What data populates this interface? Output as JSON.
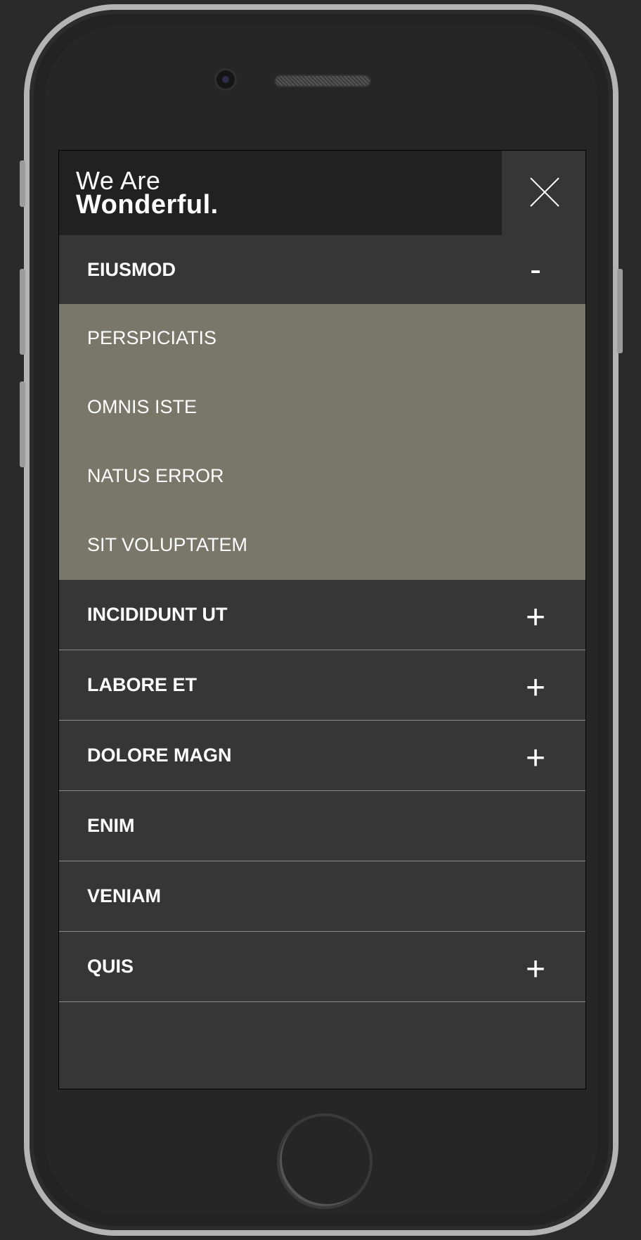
{
  "logo": {
    "line1": "We Are",
    "line2": "Wonderful."
  },
  "close_icon": "close-icon",
  "menu": {
    "expanded": {
      "label": "EIUSMOD",
      "toggle": "-",
      "children": [
        "PERSPICIATIS",
        "OMNIS ISTE",
        "NATUS ERROR",
        "SIT VOLUPTATEM"
      ]
    },
    "items": [
      {
        "label": "INCIDIDUNT UT",
        "toggle": "+"
      },
      {
        "label": "LABORE ET",
        "toggle": "+"
      },
      {
        "label": "DOLORE MAGN",
        "toggle": "+"
      },
      {
        "label": "ENIM",
        "toggle": ""
      },
      {
        "label": "VENIAM",
        "toggle": ""
      },
      {
        "label": "QUIS",
        "toggle": "+"
      }
    ]
  },
  "colors": {
    "header_bg": "#212121",
    "menu_bg": "#363636",
    "submenu_bg": "#797769",
    "divider": "#8a8a7c"
  }
}
